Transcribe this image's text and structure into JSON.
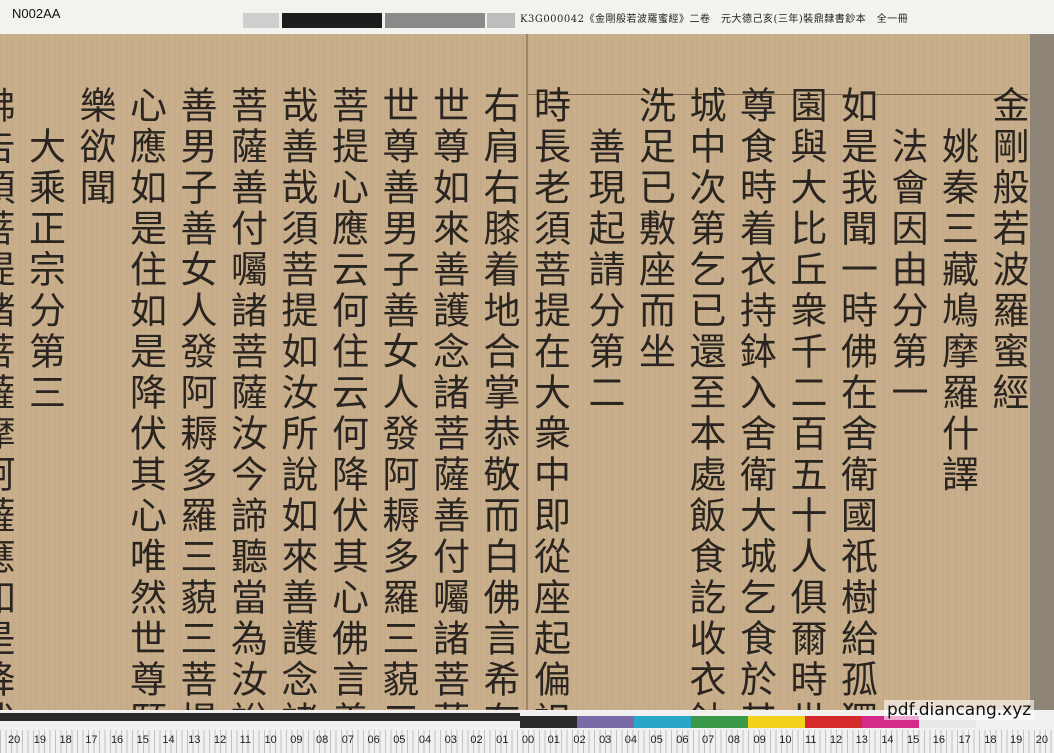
{
  "header": {
    "id_label": "N002AA",
    "catalog_text": "K3G000042《金剛般若波羅蜜經》二卷　元大德己亥(三年)裝鼎隸書鈔本　全一冊"
  },
  "columns": [
    "金剛般若波羅蜜經",
    "　姚秦三藏鳩摩羅什譯",
    "　法會因由分第一",
    "如是我聞一時佛在舍衛國祇樹給孤獨",
    "園與大比丘衆千二百五十人俱爾時世",
    "尊食時着衣持鉢入舍衛大城乞食於其",
    "城中次第乞已還至本處飯食訖收衣鉢",
    "洗足已敷座而坐",
    "　善現起請分第二",
    "時長老須菩提在大衆中即從座起偏袒",
    "右肩右膝着地合掌恭敬而白佛言希有",
    "世尊如來善護念諸菩薩善付囑諸菩薩",
    "世尊善男子善女人發阿耨多羅三藐三",
    "菩提心應云何住云何降伏其心佛言善",
    "哉善哉須菩提如汝所說如來善護念諸",
    "菩薩善付囑諸菩薩汝今諦聽當為汝說",
    "善男子善女人發阿耨多羅三藐三菩提",
    "心應如是住如是降伏其心唯然世尊願",
    "樂欲聞",
    "　大乘正宗分第三",
    "佛告須菩提諸菩薩摩訶薩應如是降伏"
  ],
  "ruler": {
    "numbers": [
      "20",
      "19",
      "18",
      "17",
      "16",
      "15",
      "14",
      "13",
      "12",
      "11",
      "10",
      "09",
      "08",
      "07",
      "06",
      "05",
      "04",
      "03",
      "02",
      "01",
      "00",
      "01",
      "02",
      "03",
      "04",
      "05",
      "06",
      "07",
      "08",
      "09",
      "10",
      "11",
      "12",
      "13",
      "14",
      "15",
      "16",
      "17",
      "18",
      "19",
      "20"
    ],
    "swatch_colors": [
      "#2a2a2a",
      "#7a6aa8",
      "#2aa7c8",
      "#3a9a4a",
      "#f2d21a",
      "#d42a2a",
      "#d42a8a",
      "#e8e8e8"
    ]
  },
  "watermark": "pdf.diancang.xyz"
}
